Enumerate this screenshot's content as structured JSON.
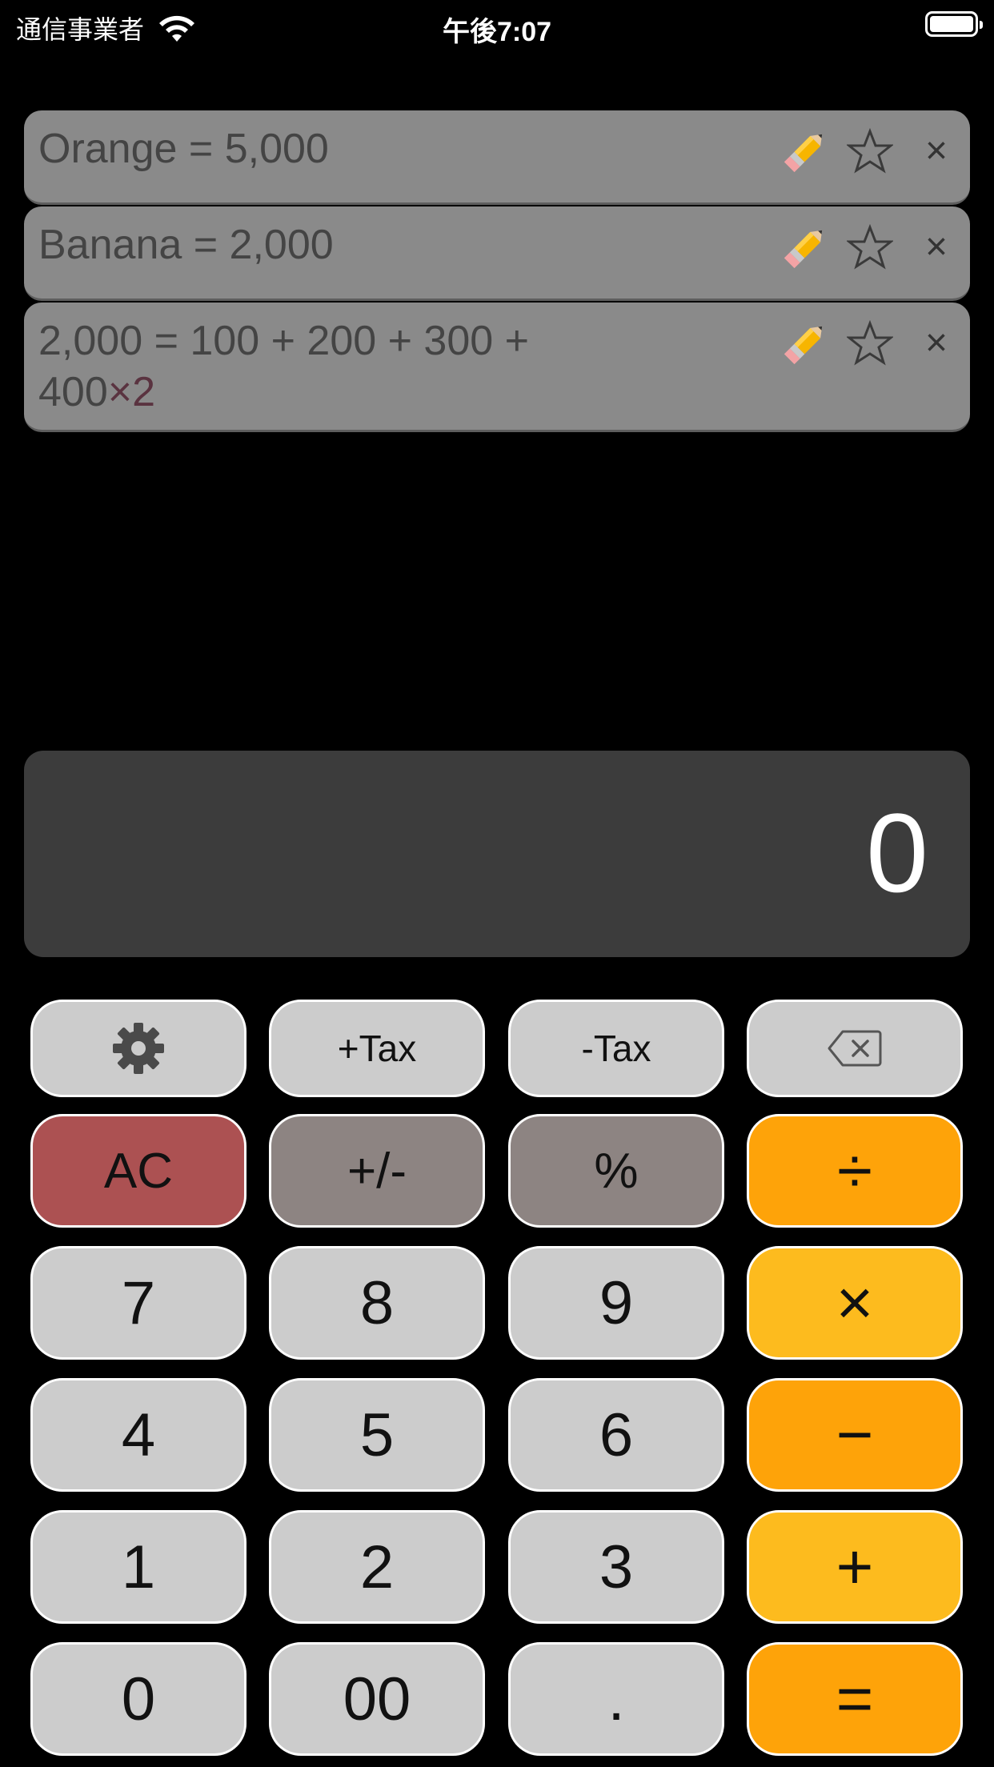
{
  "status_bar": {
    "carrier": "通信事業者",
    "time": "午後7:07"
  },
  "history": [
    {
      "expression": "Orange = 5,000"
    },
    {
      "expression": "Banana = 2,000"
    },
    {
      "line1": "2,000 = 100 + 200 + 300 +",
      "line2_value": "400",
      "line2_multiplier": "×2"
    }
  ],
  "display": {
    "value": "0"
  },
  "keys": {
    "plus_tax": "+Tax",
    "minus_tax": "-Tax",
    "ac": "AC",
    "plus_minus": "+/-",
    "percent": "%",
    "divide": "÷",
    "seven": "7",
    "eight": "8",
    "nine": "9",
    "multiply": "×",
    "four": "4",
    "five": "5",
    "six": "6",
    "minus": "−",
    "one": "1",
    "two": "2",
    "three": "3",
    "plus": "+",
    "zero": "0",
    "double_zero": "00",
    "decimal": ".",
    "equals": "="
  },
  "colors": {
    "background": "#000000",
    "history_item": "#8a8a8a",
    "display": "#3c3c3c",
    "key_default": "#cccccc",
    "key_ac": "#ac5152",
    "key_gray": "#8d8482",
    "key_orange": "#fea309",
    "key_yellow": "#fdbb1e"
  }
}
